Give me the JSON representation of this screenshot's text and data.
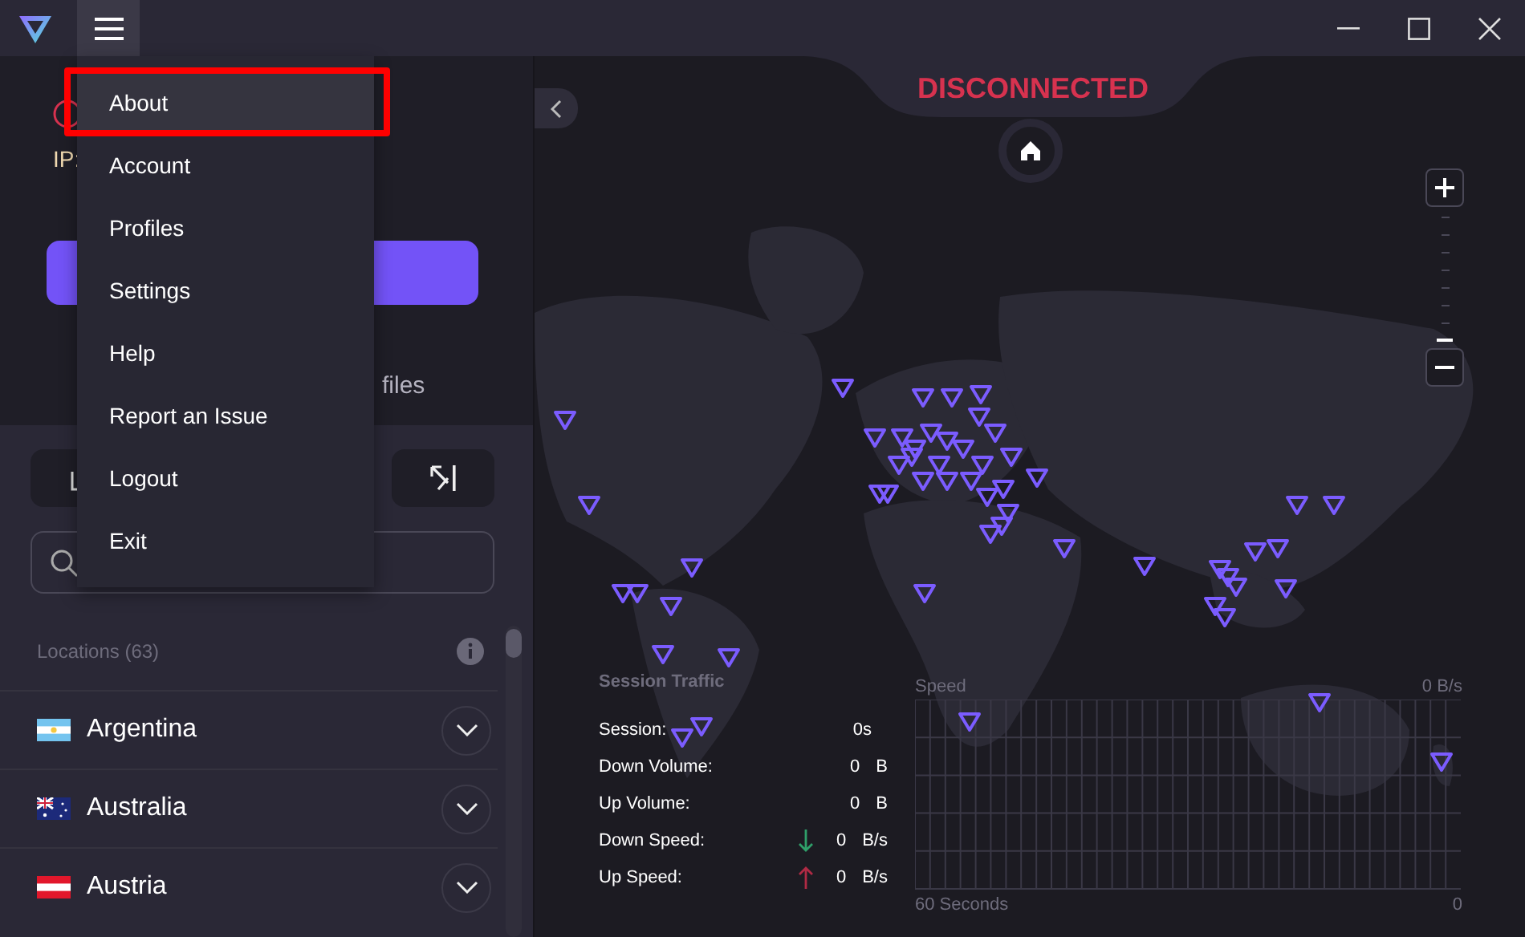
{
  "menu": {
    "open": true,
    "items": [
      {
        "label": "About",
        "selected": true,
        "annotated": true
      },
      {
        "label": "Account",
        "selected": false,
        "annotated": false
      },
      {
        "label": "Profiles",
        "selected": false,
        "annotated": false
      },
      {
        "label": "Settings",
        "selected": false,
        "annotated": false
      },
      {
        "label": "Help",
        "selected": false,
        "annotated": false
      },
      {
        "label": "Report an Issue",
        "selected": false,
        "annotated": false
      },
      {
        "label": "Logout",
        "selected": false,
        "annotated": false
      },
      {
        "label": "Exit",
        "selected": false,
        "annotated": false
      }
    ]
  },
  "sidebar": {
    "ip_label": "IP:",
    "tabs": [
      {
        "label": "files",
        "selected": false
      }
    ],
    "locations_header": "Locations (63)",
    "countries": [
      {
        "name": "Argentina",
        "kind": "ar",
        "expanded": false
      },
      {
        "name": "Australia",
        "kind": "au",
        "expanded": false
      },
      {
        "name": "Austria",
        "kind": "at",
        "expanded": false
      }
    ]
  },
  "status": {
    "text": "DISCONNECTED",
    "connected": false
  },
  "zoom": {
    "level": 0
  },
  "session_traffic": {
    "title": "Session Traffic",
    "rows": [
      {
        "label": "Session:",
        "value": "0s",
        "kind": "plain"
      },
      {
        "label": "Down Volume:",
        "value": "0",
        "unit": "B",
        "kind": "plain"
      },
      {
        "label": "Up Volume:",
        "value": "0",
        "unit": "B",
        "kind": "plain"
      },
      {
        "label": "Down Speed:",
        "value": "0",
        "unit": "B/s",
        "kind": "down"
      },
      {
        "label": "Up Speed:",
        "value": "0",
        "unit": "B/s",
        "kind": "up"
      }
    ]
  },
  "speed_graph": {
    "title": "Speed",
    "max_label": "0 B/s",
    "x_start": "60 Seconds",
    "x_end": "0"
  }
}
